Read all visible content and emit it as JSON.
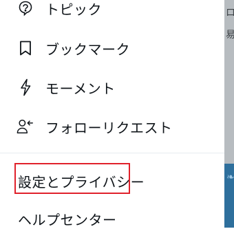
{
  "menu": {
    "items": [
      {
        "label": "トピック",
        "icon": "topic-bubble-icon"
      },
      {
        "label": "ブックマーク",
        "icon": "bookmark-icon"
      },
      {
        "label": "モーメント",
        "icon": "lightning-bolt-icon"
      },
      {
        "label": "フォローリクエスト",
        "icon": "follow-request-icon"
      }
    ],
    "settings_label": "設定とプライバシー",
    "help_label": "ヘルプセンター"
  },
  "backdrop": {
    "glyph_top": "ロ",
    "glyph_mid": "易"
  },
  "colors": {
    "highlight": "#e0202a",
    "text": "#0f1419",
    "divider": "#e6ecf0"
  }
}
